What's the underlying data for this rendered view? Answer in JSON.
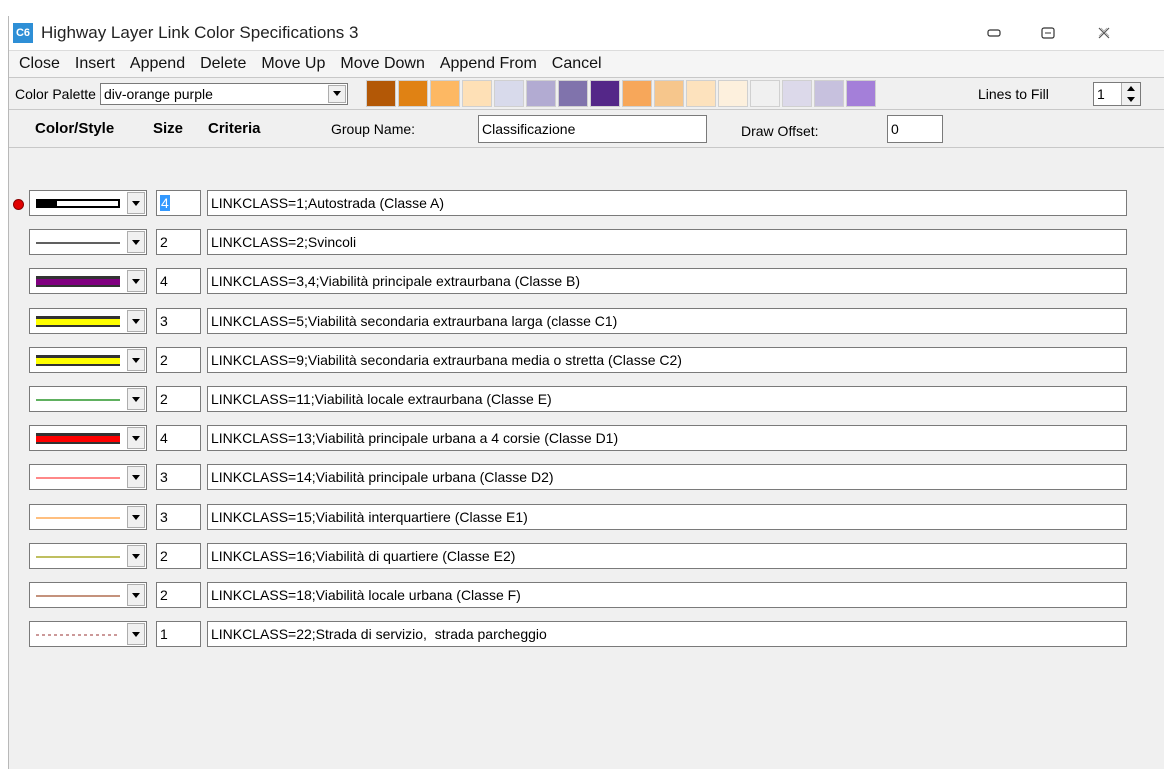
{
  "window": {
    "app_badge": "C6",
    "title": "Highway Layer Link Color Specifications 3",
    "controls": [
      "minimize",
      "maximize",
      "close"
    ]
  },
  "menu": [
    "Close",
    "Insert",
    "Append",
    "Delete",
    "Move Up",
    "Move Down",
    "Append From",
    "Cancel"
  ],
  "palette": {
    "label": "Color Palette",
    "selected": "div-orange purple",
    "swatches": [
      "#b35806",
      "#e08214",
      "#fdb863",
      "#fee0b6",
      "#d8daeb",
      "#b2abd2",
      "#8073ac",
      "#542788",
      "#f7a75a",
      "#f6c68c",
      "#fde2bd",
      "#fdf0dd",
      "#f0f0f0",
      "#dcd9ea",
      "#c7c1de",
      "#a47fd9"
    ],
    "lines_to_fill_label": "Lines to Fill",
    "lines_to_fill_value": "1"
  },
  "header": {
    "color_style": "Color/Style",
    "size": "Size",
    "criteria": "Criteria",
    "group_name_label": "Group Name:",
    "group_name_value": "Classificazione",
    "draw_offset_label": "Draw Offset:",
    "draw_offset_value": "0"
  },
  "rows": [
    {
      "style": "outlined-black",
      "color": "#000000",
      "size": "4",
      "criteria": "LINKCLASS=1;Autostrada (Classe A)",
      "selected": true
    },
    {
      "style": "thin",
      "color": "#000000",
      "size": "2",
      "criteria": "LINKCLASS=2;Svincoli"
    },
    {
      "style": "thick-outlined",
      "color": "#800080",
      "size": "4",
      "criteria": "LINKCLASS=3,4;Viabilità principale extraurbana (Classe B)"
    },
    {
      "style": "thick-outlined",
      "color": "#ffff00",
      "size": "3",
      "criteria": "LINKCLASS=5;Viabilità secondaria extraurbana larga (classe C1)"
    },
    {
      "style": "thick-outlined",
      "color": "#ffff00",
      "size": "2",
      "criteria": "LINKCLASS=9;Viabilità secondaria extraurbana media o stretta (Classe C2)"
    },
    {
      "style": "thin",
      "color": "#008000",
      "size": "2",
      "criteria": "LINKCLASS=11;Viabilità locale extraurbana (Classe E)"
    },
    {
      "style": "thick-outlined",
      "color": "#ff0000",
      "size": "4",
      "criteria": "LINKCLASS=13;Viabilità principale urbana a 4 corsie (Classe D1)"
    },
    {
      "style": "thin",
      "color": "#ff4040",
      "size": "3",
      "criteria": "LINKCLASS=14;Viabilità principale urbana (Classe D2)"
    },
    {
      "style": "thin",
      "color": "#ff9933",
      "size": "3",
      "criteria": "LINKCLASS=15;Viabilità interquartiere (Classe E1)"
    },
    {
      "style": "thin",
      "color": "#999900",
      "size": "2",
      "criteria": "LINKCLASS=16;Viabilità di quartiere (Classe E2)"
    },
    {
      "style": "thin",
      "color": "#a0522d",
      "size": "2",
      "criteria": "LINKCLASS=18;Viabilità locale urbana (Classe F)"
    },
    {
      "style": "dashed",
      "color": "#993333",
      "size": "1",
      "criteria": "LINKCLASS=22;Strada di servizio,  strada parcheggio"
    }
  ]
}
